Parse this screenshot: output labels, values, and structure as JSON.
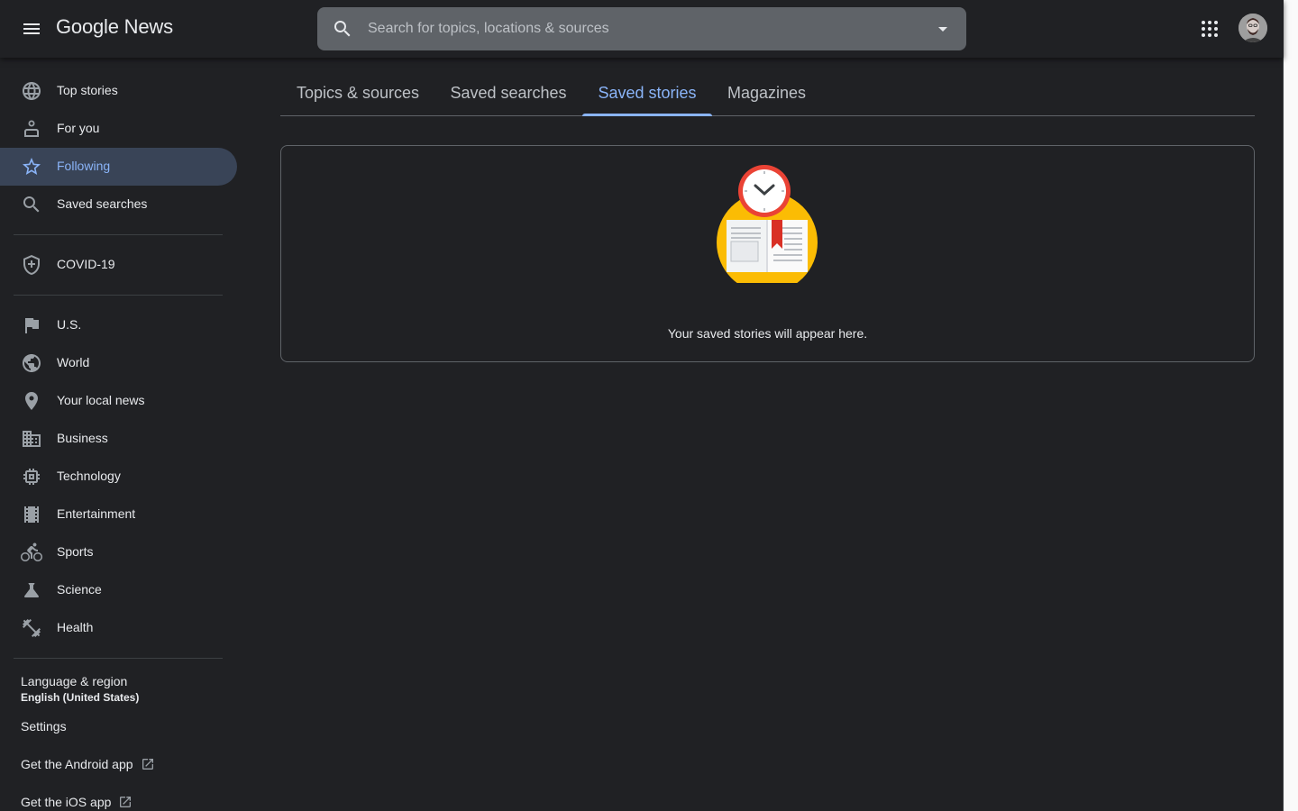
{
  "header": {
    "logo_google": "Google",
    "logo_news": "News",
    "search_placeholder": "Search for topics, locations & sources"
  },
  "sidebar": {
    "items": [
      {
        "label": "Top stories",
        "icon": "globe-icon"
      },
      {
        "label": "For you",
        "icon": "person-icon"
      },
      {
        "label": "Following",
        "icon": "star-icon",
        "active": true
      },
      {
        "label": "Saved searches",
        "icon": "search-icon"
      },
      {
        "label": "COVID-19",
        "icon": "shield-plus-icon"
      },
      {
        "label": "U.S.",
        "icon": "flag-icon"
      },
      {
        "label": "World",
        "icon": "world-icon"
      },
      {
        "label": "Your local news",
        "icon": "location-pin-icon"
      },
      {
        "label": "Business",
        "icon": "building-icon"
      },
      {
        "label": "Technology",
        "icon": "chip-icon"
      },
      {
        "label": "Entertainment",
        "icon": "film-icon"
      },
      {
        "label": "Sports",
        "icon": "bicycle-icon"
      },
      {
        "label": "Science",
        "icon": "flask-icon"
      },
      {
        "label": "Health",
        "icon": "dumbbell-icon"
      }
    ],
    "footer": {
      "language_label": "Language & region",
      "language_value": "English (United States)",
      "settings": "Settings",
      "android_app": "Get the Android app",
      "ios_app": "Get the iOS app"
    }
  },
  "tabs": [
    {
      "label": "Topics & sources"
    },
    {
      "label": "Saved searches"
    },
    {
      "label": "Saved stories",
      "active": true
    },
    {
      "label": "Magazines"
    }
  ],
  "empty_state": {
    "message": "Your saved stories will appear here.",
    "icon": "saved-stories-illustration"
  },
  "colors": {
    "background": "#202124",
    "accent": "#8ab4f8",
    "active_nav_bg": "#394457",
    "search_bg": "#5f6368"
  }
}
